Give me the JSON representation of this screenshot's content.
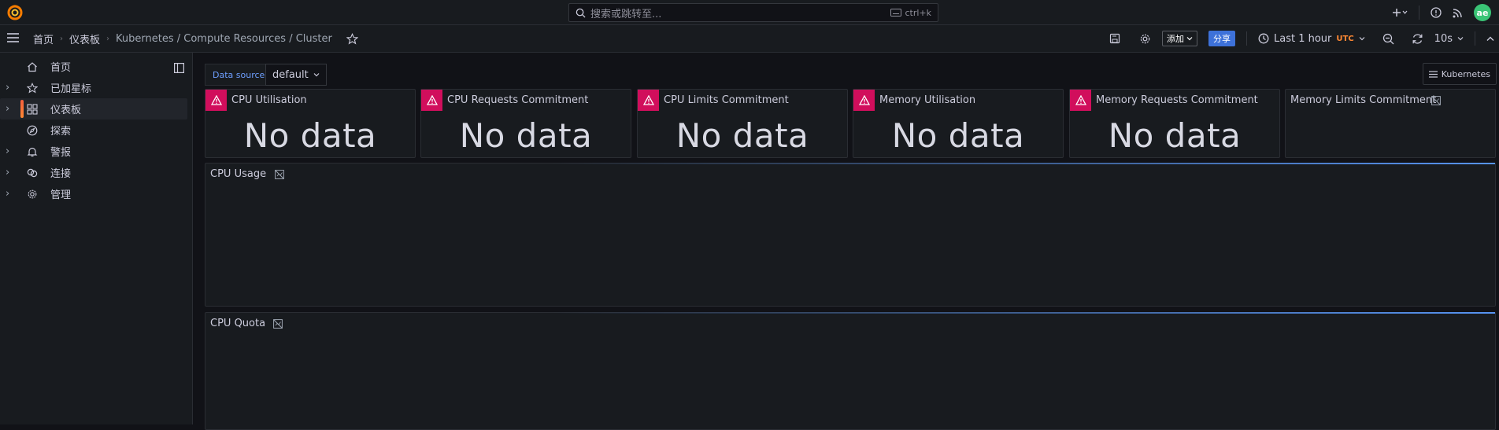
{
  "topbar": {
    "search_placeholder": "搜索或跳转至...",
    "shortcut": "ctrl+k",
    "avatar_text": "ae",
    "icons": [
      "grafana-logo-icon",
      "search-icon",
      "keyboard-icon",
      "plus-icon",
      "help-icon",
      "news-rss-icon"
    ]
  },
  "navbar": {
    "breadcrumb": [
      "首页",
      "仪表板",
      "Kubernetes / Compute Resources / Cluster"
    ],
    "add_label": "添加",
    "share_label": "分享",
    "time_range": "Last 1 hour",
    "timezone": "UTC",
    "refresh_interval": "10s"
  },
  "sidebar": {
    "items": [
      {
        "label": "首页",
        "icon": "home-icon",
        "expandable": false,
        "active": false
      },
      {
        "label": "已加星标",
        "icon": "star-icon",
        "expandable": true,
        "active": false
      },
      {
        "label": "仪表板",
        "icon": "apps-icon",
        "expandable": true,
        "active": true
      },
      {
        "label": "探索",
        "icon": "compass-icon",
        "expandable": false,
        "active": false
      },
      {
        "label": "警报",
        "icon": "bell-icon",
        "expandable": true,
        "active": false
      },
      {
        "label": "连接",
        "icon": "link-icon",
        "expandable": true,
        "active": false
      },
      {
        "label": "管理",
        "icon": "cog-icon",
        "expandable": true,
        "active": false
      }
    ]
  },
  "variables": {
    "datasource_label": "Data source",
    "datasource_value": "default",
    "links_button": "Kubernetes"
  },
  "stat_panels": [
    {
      "title": "CPU Utilisation",
      "value": "No data",
      "error": true
    },
    {
      "title": "CPU Requests Commitment",
      "value": "No data",
      "error": true
    },
    {
      "title": "CPU Limits Commitment",
      "value": "No data",
      "error": true
    },
    {
      "title": "Memory Utilisation",
      "value": "No data",
      "error": true
    },
    {
      "title": "Memory Requests Commitment",
      "value": "No data",
      "error": true
    },
    {
      "title": "Memory Limits Commitment",
      "value": "",
      "error": false
    }
  ],
  "graph_panels": [
    {
      "title": "CPU Usage"
    },
    {
      "title": "CPU Quota"
    }
  ],
  "colors": {
    "background": "#111217",
    "panel": "#181b1f",
    "border": "#2a2d33",
    "error": "#d10e5c",
    "primary": "#3d71d9",
    "accent_orange": "#ff8833",
    "text": "#ccccdc"
  }
}
